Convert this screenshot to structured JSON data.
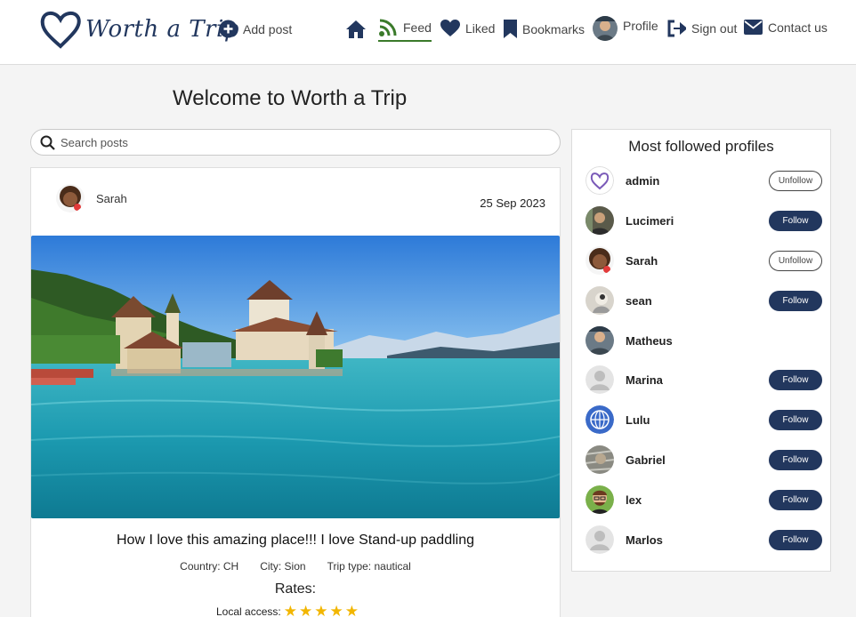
{
  "navbar": {
    "logo_text": "Worth a Trip",
    "add_post": "Add post",
    "feed": "Feed",
    "liked": "Liked",
    "bookmarks": "Bookmarks",
    "profile": "Profile",
    "sign_out": "Sign out",
    "contact": "Contact us",
    "brand_color": "#22375e",
    "active_color": "#3a7a2a"
  },
  "main": {
    "welcome": "Welcome to Worth a Trip",
    "search_placeholder": "Search posts"
  },
  "post": {
    "author": "Sarah",
    "date": "25 Sep 2023",
    "title": "How I love this amazing place!!! I love Stand-up paddling",
    "country": "Country: CH",
    "city": "City: Sion",
    "trip_type": "Trip type: nautical",
    "rates_heading": "Rates:",
    "local_access_label": "Local access:",
    "local_access_rating": 5
  },
  "sidebar": {
    "title": "Most followed profiles",
    "profiles": [
      {
        "name": "admin",
        "button": "Unfollow"
      },
      {
        "name": "Lucimeri",
        "button": "Follow"
      },
      {
        "name": "Sarah",
        "button": "Unfollow"
      },
      {
        "name": "sean",
        "button": "Follow"
      },
      {
        "name": "Matheus",
        "button": ""
      },
      {
        "name": "Marina",
        "button": "Follow"
      },
      {
        "name": "Lulu",
        "button": "Follow"
      },
      {
        "name": "Gabriel",
        "button": "Follow"
      },
      {
        "name": "lex",
        "button": "Follow"
      },
      {
        "name": "Marlos",
        "button": "Follow"
      }
    ]
  }
}
